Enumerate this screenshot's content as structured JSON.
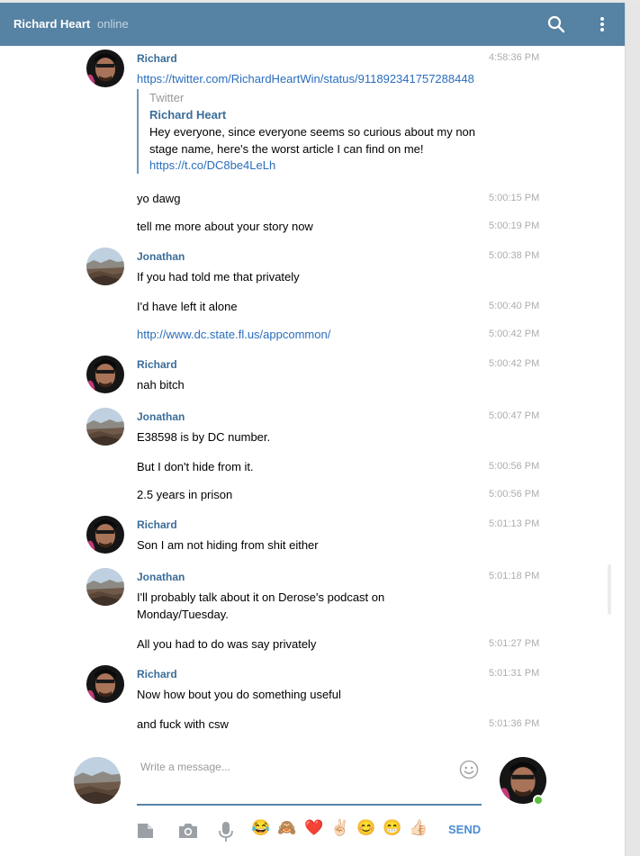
{
  "header": {
    "title": "Richard Heart",
    "status": "online"
  },
  "messages": {
    "m1": {
      "name": "Richard",
      "time": "4:58:36 PM",
      "link": "https://twitter.com/RichardHeartWin/status/911892341757288448",
      "preview": {
        "source": "Twitter",
        "author": "Richard Heart",
        "text": "Hey everyone, since everyone seems so curious about my non stage name, here's the worst article I can find on me!",
        "link": "https://t.co/DC8be4LeLh"
      }
    },
    "m2": {
      "text": "yo dawg",
      "time": "5:00:15 PM"
    },
    "m3": {
      "text": "tell me more about your story now",
      "time": "5:00:19 PM"
    },
    "m4": {
      "name": "Jonathan",
      "time": "5:00:38 PM",
      "text": "If you had told me that privately"
    },
    "m5": {
      "text": "I'd have left it alone",
      "time": "5:00:40 PM"
    },
    "m6": {
      "link": "http://www.dc.state.fl.us/appcommon/",
      "time": "5:00:42 PM"
    },
    "m7": {
      "name": "Richard",
      "time": "5:00:42 PM",
      "text": "nah bitch"
    },
    "m8": {
      "name": "Jonathan",
      "time": "5:00:47 PM",
      "text": "E38598 is by DC number."
    },
    "m9": {
      "text": "But I don't hide from it.",
      "time": "5:00:56 PM"
    },
    "m10": {
      "text": "2.5 years in prison",
      "time": "5:00:56 PM"
    },
    "m11": {
      "name": "Richard",
      "time": "5:01:13 PM",
      "text": "Son I am not hiding from shit either"
    },
    "m12": {
      "name": "Jonathan",
      "time": "5:01:18 PM",
      "text": "I'll probably talk about it on Derose's podcast on Monday/Tuesday."
    },
    "m13": {
      "text": "All you had to do was say privately",
      "time": "5:01:27 PM"
    },
    "m14": {
      "name": "Richard",
      "time": "5:01:31 PM",
      "text": "Now how bout you do something useful"
    },
    "m15": {
      "text": "and fuck with csw",
      "time": "5:01:36 PM"
    }
  },
  "composer": {
    "placeholder": "Write a message...",
    "send_label": "SEND",
    "emojis": [
      "😂",
      "🙈",
      "❤️",
      "✌🏻",
      "😊",
      "😁",
      "👍🏻"
    ]
  },
  "colors": {
    "header_bg": "#5682a3",
    "name": "#3a6d99",
    "link": "#2a6dbd",
    "online": "#5bbf3e"
  }
}
